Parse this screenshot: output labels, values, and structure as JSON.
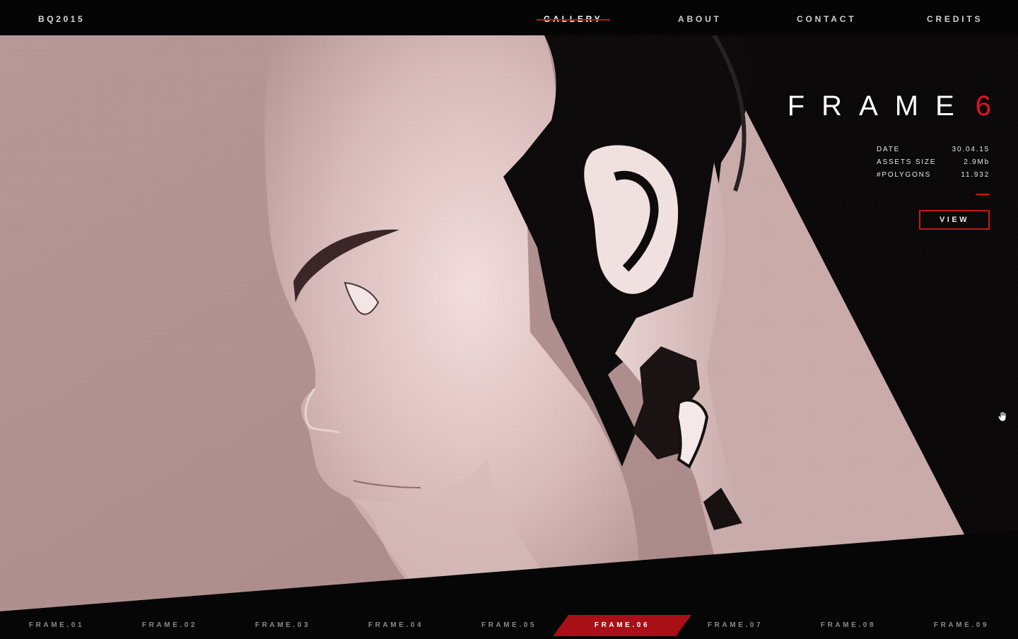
{
  "app": {
    "brand": "BQ2015"
  },
  "nav": {
    "items": [
      {
        "label": "GALLERY",
        "active": true
      },
      {
        "label": "ABOUT",
        "active": false
      },
      {
        "label": "CONTACT",
        "active": false
      },
      {
        "label": "CREDITS",
        "active": false
      }
    ]
  },
  "frame": {
    "title_word": "FRAME",
    "number": "6",
    "meta": [
      {
        "label": "DATE",
        "value": "30.04.15"
      },
      {
        "label": "ASSETS SIZE",
        "value": "2.9Mb"
      },
      {
        "label": "#POLYGONS",
        "value": "11.932"
      }
    ],
    "view_label": "VIEW"
  },
  "strip": {
    "items": [
      "FRAME.01",
      "FRAME.02",
      "FRAME.03",
      "FRAME.04",
      "FRAME.05",
      "FRAME.06",
      "FRAME.07",
      "FRAME.08",
      "FRAME.09"
    ],
    "active_index": 5
  },
  "colors": {
    "accent": "#d11219",
    "background": "#050505",
    "skin": "#c9a8a6"
  },
  "icons": {
    "cursor": "grab-hand-cursor-icon"
  }
}
